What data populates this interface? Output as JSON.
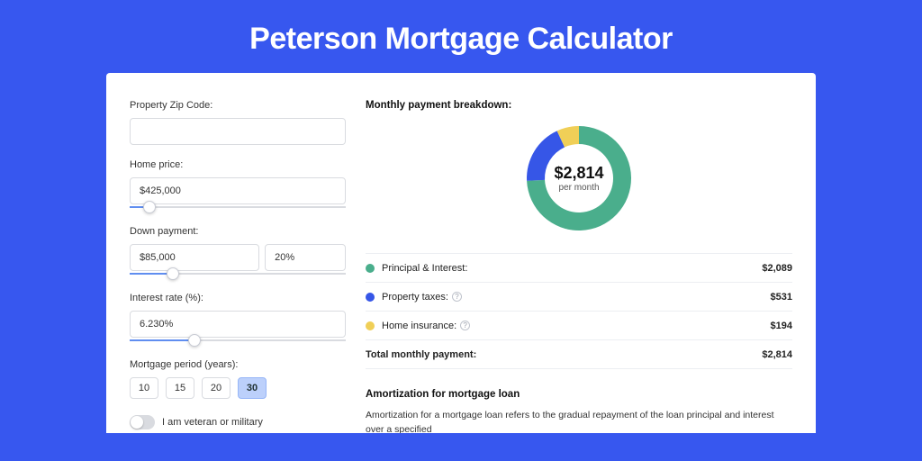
{
  "title": "Peterson Mortgage Calculator",
  "form": {
    "zip_label": "Property Zip Code:",
    "zip_value": "",
    "home_price_label": "Home price:",
    "home_price_value": "$425,000",
    "home_price_slider_pct": 9,
    "down_payment_label": "Down payment:",
    "down_payment_value": "$85,000",
    "down_payment_pct_value": "20%",
    "down_payment_slider_pct": 20,
    "interest_label": "Interest rate (%):",
    "interest_value": "6.230%",
    "interest_slider_pct": 30,
    "period_label": "Mortgage period (years):",
    "period_options": [
      "10",
      "15",
      "20",
      "30"
    ],
    "period_selected": "30",
    "veteran_label": "I am veteran or military",
    "veteran_on": false
  },
  "breakdown": {
    "title": "Monthly payment breakdown:",
    "center_amount": "$2,814",
    "center_unit": "per month",
    "items": [
      {
        "label": "Principal & Interest:",
        "value": "$2,089",
        "color": "#4aae8c",
        "help": false
      },
      {
        "label": "Property taxes:",
        "value": "$531",
        "color": "#3656e7",
        "help": true
      },
      {
        "label": "Home insurance:",
        "value": "$194",
        "color": "#f0cf57",
        "help": true
      }
    ],
    "total_label": "Total monthly payment:",
    "total_value": "$2,814"
  },
  "chart_data": {
    "type": "pie",
    "title": "Monthly payment breakdown",
    "categories": [
      "Principal & Interest",
      "Property taxes",
      "Home insurance"
    ],
    "values": [
      2089,
      531,
      194
    ],
    "colors": [
      "#4aae8c",
      "#3656e7",
      "#f0cf57"
    ],
    "center_label": "$2,814 per month"
  },
  "amortization": {
    "title": "Amortization for mortgage loan",
    "text": "Amortization for a mortgage loan refers to the gradual repayment of the loan principal and interest over a specified"
  }
}
